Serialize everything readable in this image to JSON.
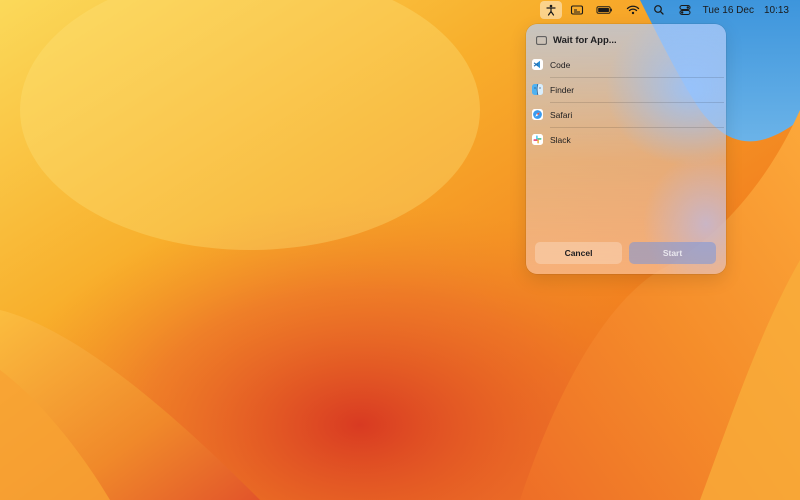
{
  "menubar": {
    "icons": [
      "accessibility-icon",
      "caption-icon",
      "battery-icon",
      "wifi-icon",
      "search-icon",
      "control-center-icon"
    ],
    "date": "Tue 16 Dec",
    "time": "10:13"
  },
  "panel": {
    "title": "Wait for App...",
    "title_icon": "window-icon",
    "apps": [
      {
        "label": "Code",
        "icon": "vscode-icon"
      },
      {
        "label": "Finder",
        "icon": "finder-icon"
      },
      {
        "label": "Safari",
        "icon": "safari-icon"
      },
      {
        "label": "Slack",
        "icon": "slack-icon"
      }
    ],
    "cancel_label": "Cancel",
    "start_label": "Start"
  },
  "colors": {
    "wallpaper_orange": "#f4a11e",
    "wallpaper_red": "#e4502a",
    "wallpaper_yellow": "#f9d24d",
    "wallpaper_blue": "#4aa0e0",
    "start_button": "#8aa2df"
  }
}
